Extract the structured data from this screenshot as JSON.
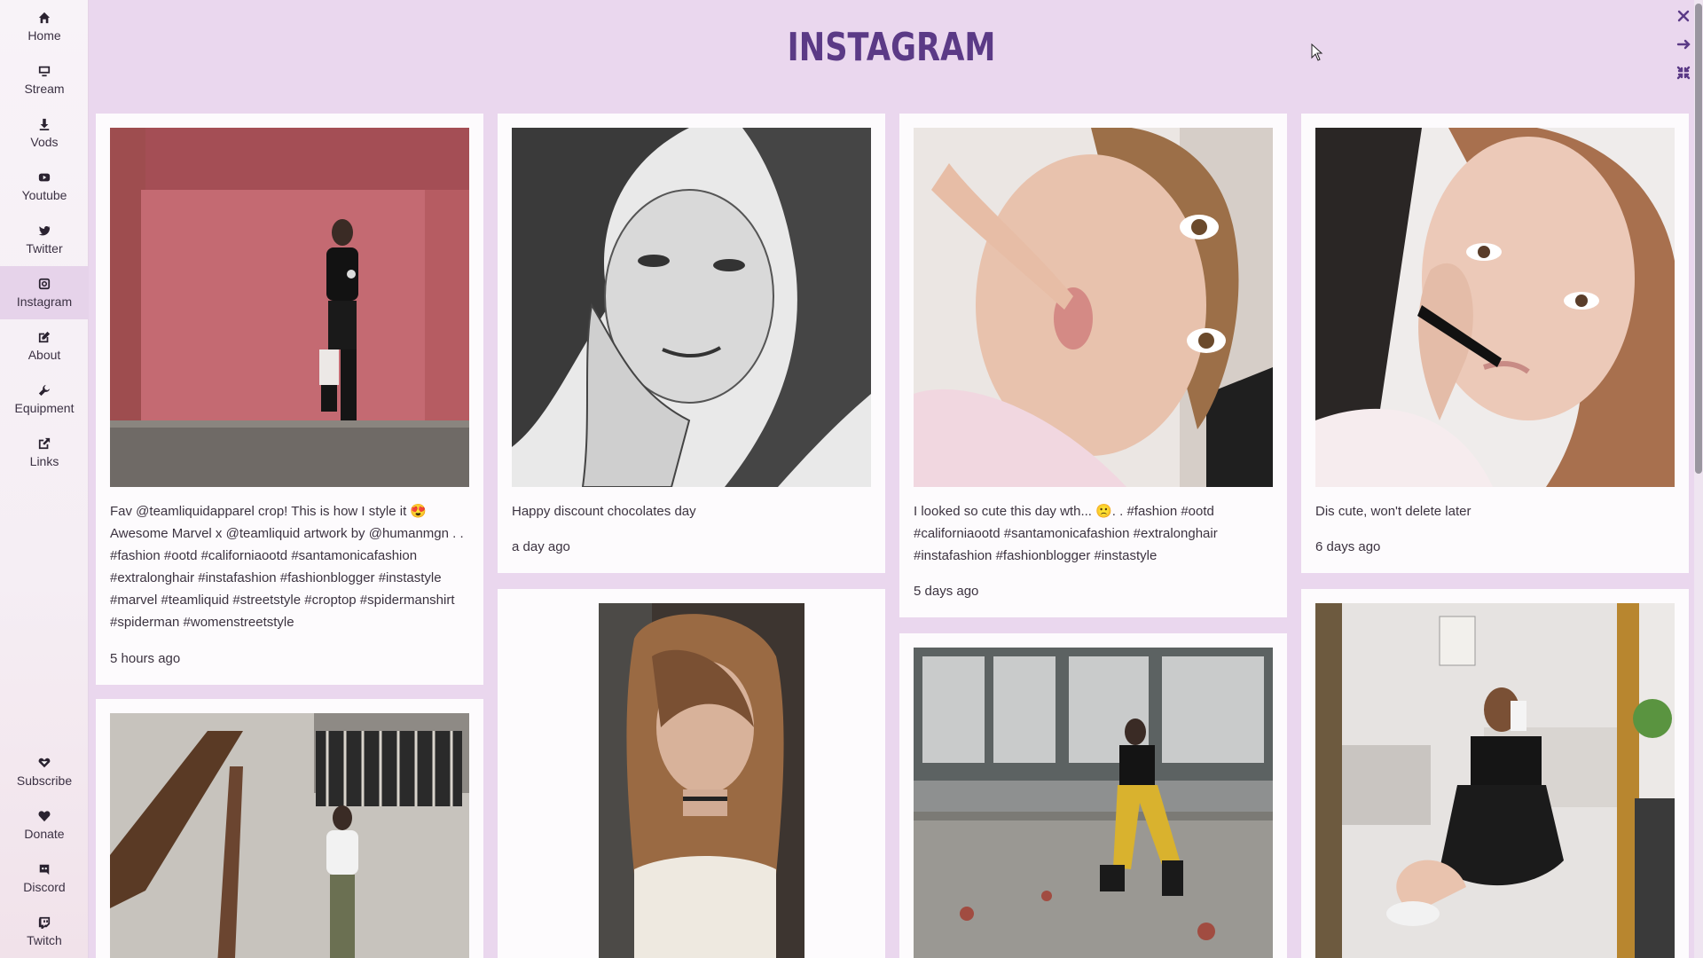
{
  "page_title": "INSTAGRAM",
  "accent_color": "#5b3a86",
  "sidebar": {
    "top_items": [
      {
        "label": "Home",
        "icon": "home-icon"
      },
      {
        "label": "Stream",
        "icon": "monitor-icon"
      },
      {
        "label": "Vods",
        "icon": "download-icon"
      },
      {
        "label": "Youtube",
        "icon": "youtube-icon"
      },
      {
        "label": "Twitter",
        "icon": "twitter-icon"
      },
      {
        "label": "Instagram",
        "icon": "instagram-icon",
        "active": true
      },
      {
        "label": "About",
        "icon": "edit-icon"
      },
      {
        "label": "Equipment",
        "icon": "wrench-icon"
      },
      {
        "label": "Links",
        "icon": "external-link-icon"
      }
    ],
    "bottom_items": [
      {
        "label": "Subscribe",
        "icon": "gem-heart-icon"
      },
      {
        "label": "Donate",
        "icon": "heart-icon"
      },
      {
        "label": "Discord",
        "icon": "discord-icon"
      },
      {
        "label": "Twitch",
        "icon": "twitch-icon"
      }
    ]
  },
  "window_controls": [
    "close-icon",
    "arrow-right-icon",
    "collapse-icon"
  ],
  "posts": [
    {
      "caption": "Fav @teamliquidapparel crop! This is how I style it 😍 Awesome Marvel x @teamliquid artwork by @humanmgn . . #fashion #ootd #californiaootd #santamonicafashion #extralonghair #instafashion #fashionblogger #instastyle #marvel #teamliquid #streetstyle #croptop #spidermanshirt #spiderman #womenstreetstyle",
      "time": "5 hours ago"
    },
    {
      "caption": "Happy discount chocolates day",
      "time": "a day ago"
    },
    {
      "caption": "I looked so cute this day wth... 🙁. . #fashion #ootd #californiaootd #santamonicafashion #extralonghair #instafashion #fashionblogger #instastyle",
      "time": "5 days ago"
    },
    {
      "caption": "Dis cute, won't delete later",
      "time": "6 days ago"
    }
  ]
}
